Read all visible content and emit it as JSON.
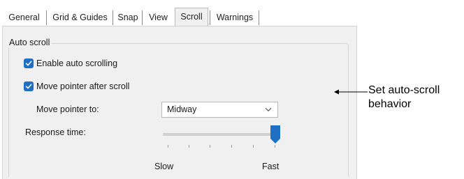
{
  "tabs": [
    {
      "label": "General",
      "active": false
    },
    {
      "label": "Grid & Guides",
      "active": false
    },
    {
      "label": "Snap",
      "active": false
    },
    {
      "label": "View",
      "active": false
    },
    {
      "label": "Scroll",
      "active": true
    },
    {
      "label": "Warnings",
      "active": false
    }
  ],
  "auto_scroll": {
    "group_label": "Auto scroll",
    "enable_auto_scrolling": {
      "label": "Enable auto scrolling",
      "checked": true
    },
    "move_pointer_after_scroll": {
      "label": "Move pointer after scroll",
      "checked": true
    },
    "move_pointer_to": {
      "label": "Move pointer to:",
      "value": "Midway"
    },
    "response_time": {
      "label": "Response time:",
      "value": 1.0,
      "min_label": "Slow",
      "max_label": "Fast"
    }
  },
  "annotation": {
    "text_line1": "Set auto-scroll",
    "text_line2": "behavior"
  },
  "colors": {
    "accent": "#1f6fc5",
    "panel_bg": "#f0f0f0"
  },
  "icons": {
    "checkbox_check": "checkmark-icon",
    "dropdown": "chevron-down-icon",
    "callout": "arrow-left-icon"
  }
}
